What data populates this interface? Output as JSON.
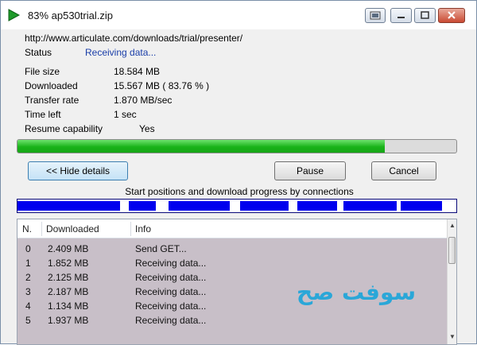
{
  "window": {
    "title": "83% ap530trial.zip"
  },
  "details": {
    "url": "http://www.articulate.com/downloads/trial/presenter/",
    "status_label": "Status",
    "status_value": "Receiving data...",
    "rows": [
      {
        "label": "File size",
        "value": "18.584  MB"
      },
      {
        "label": "Downloaded",
        "value": "15.567  MB  ( 83.76 % )"
      },
      {
        "label": "Transfer rate",
        "value": "1.870  MB/sec"
      },
      {
        "label": "Time left",
        "value": "1 sec"
      },
      {
        "label": "Resume capability",
        "value": "Yes"
      }
    ]
  },
  "progress": {
    "fraction": 0.8376
  },
  "buttons": {
    "hide_details": "<< Hide details",
    "pause": "Pause",
    "cancel": "Cancel"
  },
  "connections": {
    "caption": "Start positions and download progress by connections",
    "segments": [
      {
        "start": 0.0,
        "end": 0.233
      },
      {
        "start": 0.254,
        "end": 0.316
      },
      {
        "start": 0.345,
        "end": 0.483
      },
      {
        "start": 0.508,
        "end": 0.618
      },
      {
        "start": 0.638,
        "end": 0.728
      },
      {
        "start": 0.743,
        "end": 0.864
      },
      {
        "start": 0.873,
        "end": 0.968
      }
    ]
  },
  "table": {
    "columns": [
      "N.",
      "Downloaded",
      "Info"
    ],
    "rows": [
      [
        "0",
        "2.409  MB",
        "Send GET..."
      ],
      [
        "1",
        "1.852  MB",
        "Receiving data..."
      ],
      [
        "2",
        "2.125  MB",
        "Receiving data..."
      ],
      [
        "3",
        "2.187  MB",
        "Receiving data..."
      ],
      [
        "4",
        "1.134  MB",
        "Receiving data..."
      ],
      [
        "5",
        "1.937  MB",
        "Receiving data..."
      ]
    ]
  },
  "watermark": {
    "text": "سوفت صح"
  },
  "colors": {
    "progress": "#19b319",
    "connections": "#0000ee",
    "rows_bg": "#c8bfc8",
    "status": "#1a3ea8"
  }
}
